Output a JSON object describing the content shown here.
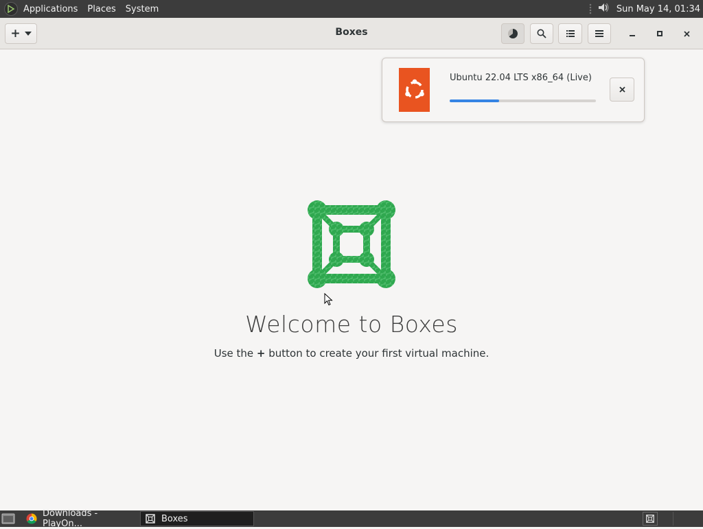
{
  "top_panel": {
    "menus": [
      "Applications",
      "Places",
      "System"
    ],
    "clock": "Sun May 14, 01:34",
    "icons": [
      "mate-logo-icon",
      "volume-icon"
    ]
  },
  "headerbar": {
    "title": "Boxes",
    "new_button_icon": "plus-icon",
    "buttons": [
      "downloads-icon",
      "search-icon",
      "list-view-icon",
      "hamburger-menu-icon"
    ],
    "window_controls": [
      "minimize-icon",
      "maximize-icon",
      "close-icon"
    ]
  },
  "downloads": {
    "item_name": "Ubuntu 22.04 LTS x86_64 (Live)",
    "progress": 0.34,
    "os_icon": "ubuntu-logo-icon",
    "os_color": "#e95420",
    "cancel_icon": "close-icon"
  },
  "welcome": {
    "title": "Welcome to Boxes",
    "subtitle_before": "Use the ",
    "subtitle_plus": "+",
    "subtitle_after": " button to create your first virtual machine."
  },
  "taskbar": {
    "tasks": [
      {
        "label": "Downloads - PlayOn...",
        "icon": "chrome-icon"
      },
      {
        "label": "Boxes",
        "icon": "boxes-icon"
      }
    ]
  },
  "colors": {
    "accent": "#3584e4",
    "logo_green": "#2fa84f",
    "panel": "#3c3c3c",
    "background": "#f6f5f4"
  }
}
